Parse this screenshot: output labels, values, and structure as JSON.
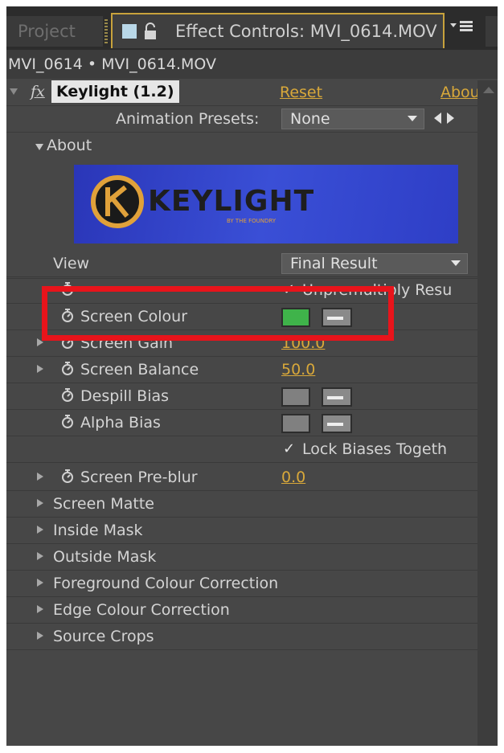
{
  "tabs": {
    "project": "Project",
    "effect_controls": "Effect Controls: MVI_0614.MOV"
  },
  "breadcrumb": "MVI_0614 • MVI_0614.MOV",
  "effect": {
    "fx_icon": "fx",
    "name": "Keylight (1.2)",
    "reset": "Reset",
    "about": "About"
  },
  "animation_presets": {
    "label": "Animation Presets:",
    "value": "None"
  },
  "about_section": {
    "label": "About",
    "logo_text": "KEYLIGHT",
    "logo_sub": "BY THE FOUNDRY",
    "logo_colors": {
      "background": "#2e3ec6",
      "ring": "#e0a13a",
      "text": "#1e1e1e"
    }
  },
  "view": {
    "label": "View",
    "value": "Final Result"
  },
  "unpremultiply": {
    "label": "Unpremultiply Resu",
    "checked": true
  },
  "screen_colour": {
    "label": "Screen Colour",
    "color": "#3fb34a"
  },
  "screen_gain": {
    "label": "Screen Gain",
    "value": "100.0"
  },
  "screen_balance": {
    "label": "Screen Balance",
    "value": "50.0"
  },
  "despill_bias": {
    "label": "Despill Bias",
    "color": "#808080"
  },
  "alpha_bias": {
    "label": "Alpha Bias",
    "color": "#808080"
  },
  "lock_biases": {
    "label": "Lock Biases Togeth",
    "checked": true
  },
  "screen_preblur": {
    "label": "Screen Pre-blur",
    "value": "0.0"
  },
  "sections": [
    "Screen Matte",
    "Inside Mask",
    "Outside Mask",
    "Foreground Colour Correction",
    "Edge Colour Correction",
    "Source Crops"
  ],
  "highlight_color": "#e8141b",
  "accent_link_color": "#d8a83a"
}
